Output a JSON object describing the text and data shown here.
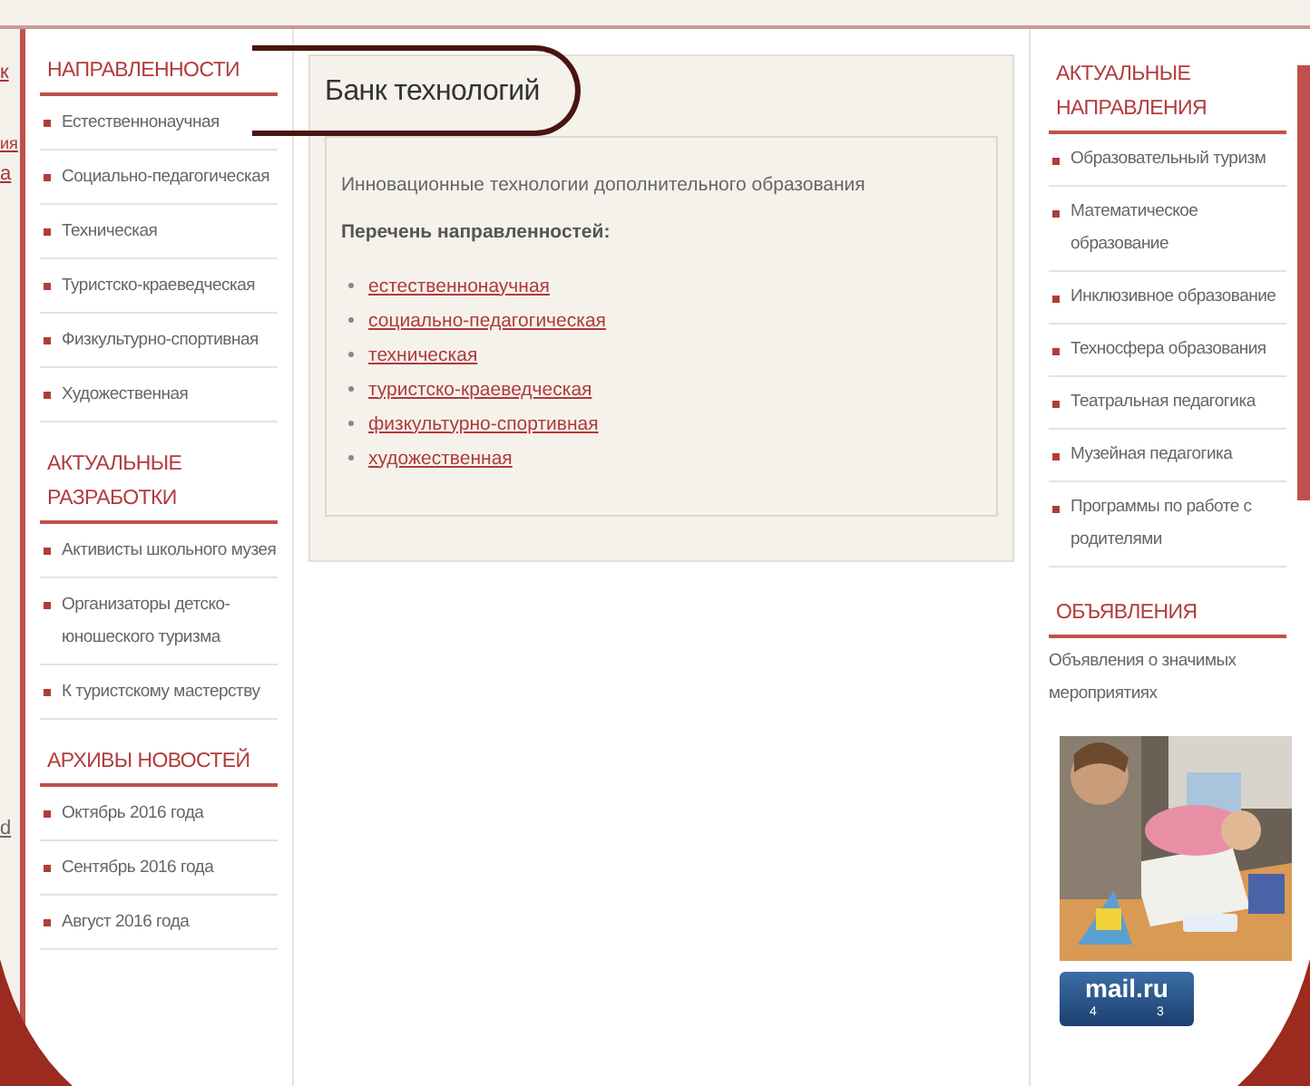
{
  "edge_fragments": [
    "к",
    "ия",
    "а",
    "d"
  ],
  "left_sidebar": {
    "sections": [
      {
        "title": "НАПРАВЛЕННОСТИ",
        "items": [
          "Естественнонаучная",
          "Социально-педагогическая",
          "Техническая",
          "Туристско-краеведческая",
          "Физкультурно-спортивная",
          "Художественная"
        ]
      },
      {
        "title": "АКТУАЛЬНЫЕ РАЗРАБОТКИ",
        "items": [
          "Активисты школьного музея",
          "Организаторы детско-юношеского туризма",
          "К туристскому мастерству"
        ]
      },
      {
        "title": "АРХИВЫ НОВОСТЕЙ",
        "items": [
          "Октябрь 2016 года",
          "Сентябрь 2016 года",
          "Август 2016 года"
        ]
      }
    ]
  },
  "main": {
    "title": "Банк технологий",
    "intro": "Инновационные технологии дополнительного образования",
    "list_heading": "Перечень направленностей:",
    "links": [
      "естественнонаучная",
      "социально-педагогическая",
      "техническая",
      "туристско-краеведческая",
      "физкультурно-спортивная",
      "художественная"
    ]
  },
  "right_sidebar": {
    "sections": [
      {
        "title": "АКТУАЛЬНЫЕ НАПРАВЛЕНИЯ",
        "items": [
          "Образовательный туризм",
          "Математическое образование",
          "Инклюзивное образование",
          "Техносфера образования",
          "Театральная педагогика",
          "Музейная педагогика",
          "Программы по работе с родителями"
        ]
      }
    ],
    "announcements": {
      "title": "ОБЪЯВЛЕНИЯ",
      "text": "Объявления о значимых мероприятиях",
      "counter": {
        "logo": "mail.ru",
        "values": [
          "4",
          "3"
        ]
      }
    }
  }
}
